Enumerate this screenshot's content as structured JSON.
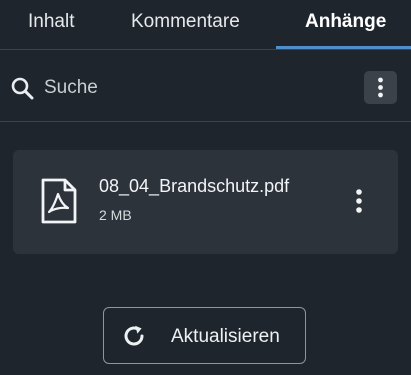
{
  "tabs": [
    {
      "label": "Inhalt",
      "active": false
    },
    {
      "label": "Kommentare",
      "active": false
    },
    {
      "label": "Anhänge",
      "active": true
    }
  ],
  "search": {
    "placeholder": "Suche",
    "value": ""
  },
  "attachments": [
    {
      "file_name": "08_04_Brandschutz.pdf",
      "size": "2 MB",
      "icon": "pdf-file-icon"
    }
  ],
  "refresh_button": {
    "label": "Aktualisieren",
    "icon": "refresh-icon"
  },
  "colors": {
    "background": "#1f252c",
    "card": "#2c333b",
    "accent": "#4f8fcc",
    "text": "#e9edf1"
  }
}
